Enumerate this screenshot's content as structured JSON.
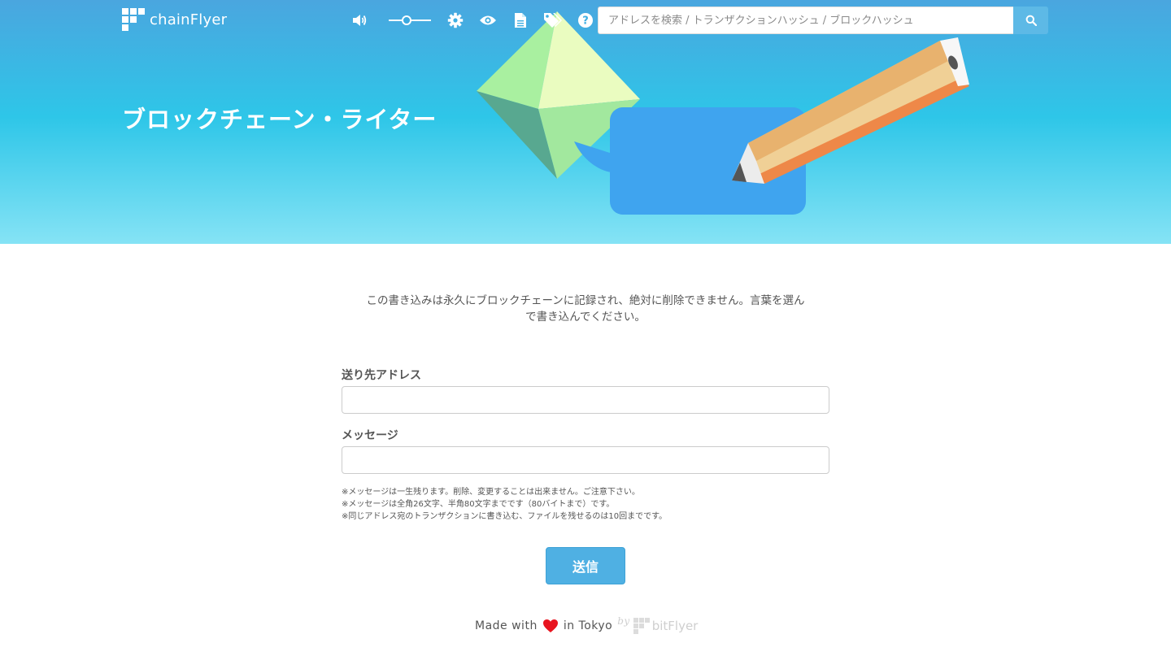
{
  "header": {
    "brand": "chainFlyer",
    "search_placeholder": "アドレスを検索 / トランザクションハッシュ / ブロックハッシュ",
    "icons": [
      "volume-icon",
      "volume-slider",
      "gear-icon",
      "eye-icon",
      "document-icon",
      "tags-icon",
      "help-icon",
      "search-icon"
    ],
    "volume_level": 0.42
  },
  "hero": {
    "title": "ブロックチェーン・ライター"
  },
  "main": {
    "intro_line1": "この書き込みは永久にブロックチェーンに記録され、絶対に削除できません。言葉を選ん",
    "intro_line2": "で書き込んでください。",
    "address_label": "送り先アドレス",
    "address_value": "",
    "message_label": "メッセージ",
    "message_value": "",
    "notes": [
      "※メッセージは一生残ります。削除、変更することは出来ません。ご注意下さい。",
      "※メッセージは全角26文字、半角80文字までです（80バイトまで）です。",
      "※同じアドレス宛のトランザクションに書き込む、ファイルを残せるのは10回までです。"
    ],
    "submit_label": "送信"
  },
  "footer": {
    "made_with": "Made with",
    "in_tokyo": "in Tokyo",
    "by": "by",
    "company": "bitFlyer"
  },
  "colors": {
    "hero_top": "#4aa6df",
    "hero_bottom": "#85e3f5",
    "button": "#4fb0e3",
    "heart": "#e8141f"
  }
}
